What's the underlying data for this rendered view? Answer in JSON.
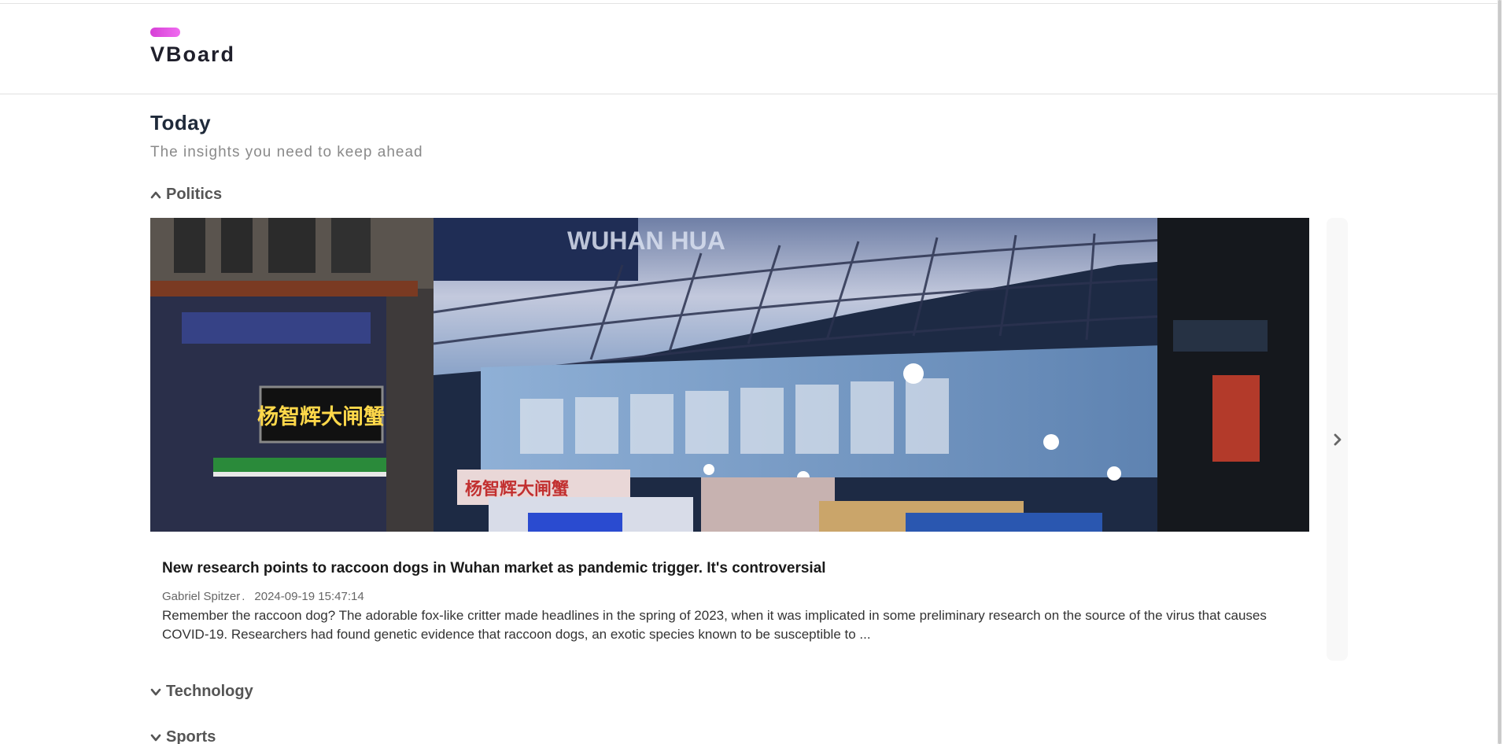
{
  "brand": {
    "name": "VBoard",
    "logo_colors": [
      "#d63fd6",
      "#f06cf0"
    ]
  },
  "page": {
    "title": "Today",
    "subtitle": "The insights you need to keep ahead"
  },
  "sections": [
    {
      "label": "Politics",
      "state": "expanded",
      "icon": "chevron-up-icon"
    },
    {
      "label": "Technology",
      "state": "collapsed",
      "icon": "chevron-down-icon"
    },
    {
      "label": "Sports",
      "state": "collapsed",
      "icon": "chevron-down-icon"
    }
  ],
  "featured_article": {
    "title": "New research points to raccoon dogs in Wuhan market as pandemic trigger. It's controversial",
    "author": "Gabriel Spitzer",
    "separator": ".",
    "timestamp": "2024-09-19 15:47:14",
    "summary": "Remember the raccoon dog? The adorable fox-like critter made headlines in the spring of 2023, when it was implicated in some preliminary research on the source of the virus that causes COVID-19. Researchers had found genetic evidence that raccoon dogs, an exotic species known to be susceptible to ...",
    "image": {
      "sign_text": "WUHAN HUA",
      "shop_sign_text": "杨智辉大闸蟹",
      "banner_text": "杨智辉大闸蟹"
    }
  },
  "carousel": {
    "next_icon": "chevron-right-icon"
  }
}
